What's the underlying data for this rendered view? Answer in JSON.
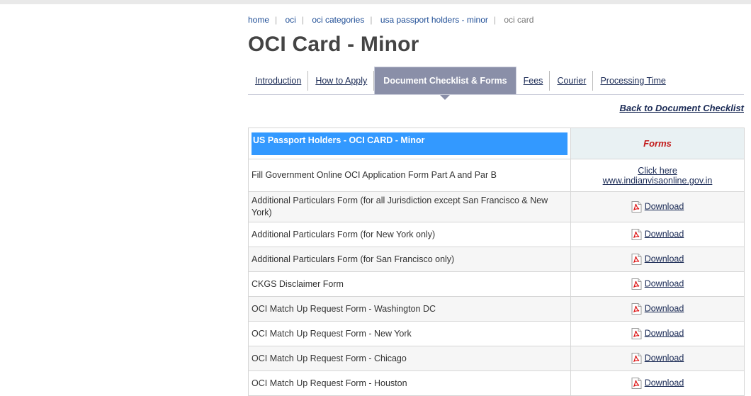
{
  "breadcrumb": {
    "items": [
      "home",
      "oci",
      "oci categories",
      "usa passport holders - minor"
    ],
    "current": "oci card"
  },
  "page_title": "OCI Card - Minor",
  "tabs": [
    {
      "label": "Introduction",
      "active": false
    },
    {
      "label": "How to Apply",
      "active": false
    },
    {
      "label": "Document Checklist & Forms",
      "active": true
    },
    {
      "label": "Fees",
      "active": false
    },
    {
      "label": "Courier",
      "active": false
    },
    {
      "label": "Processing Time",
      "active": false
    }
  ],
  "back_link": "Back to Document Checklist",
  "table": {
    "header_title": "US Passport Holders - OCI CARD - Minor",
    "header_forms": "Forms",
    "first_row": {
      "description": "Fill Government Online OCI Application Form Part A and Par B",
      "link_label": "Click here",
      "link_url_text": "www.indianvisaonline.gov.in"
    },
    "download_label": "Download",
    "rows": [
      "Additional Particulars Form (for all Jurisdiction except San Francisco & New York)",
      "Additional Particulars Form (for New York only)",
      "Additional Particulars Form (for San Francisco only)",
      "CKGS Disclaimer Form",
      "OCI Match Up Request Form - Washington DC",
      "OCI Match Up Request Form - New York",
      "OCI Match Up Request Form - Chicago",
      "OCI Match Up Request Form - Houston"
    ]
  },
  "icons": {
    "download": "pdf-file-icon"
  },
  "colors": {
    "header_highlight": "#3399ff",
    "forms_header_text": "#c21a1a",
    "active_tab": "#8a8fa8",
    "link": "#1a2a55"
  }
}
